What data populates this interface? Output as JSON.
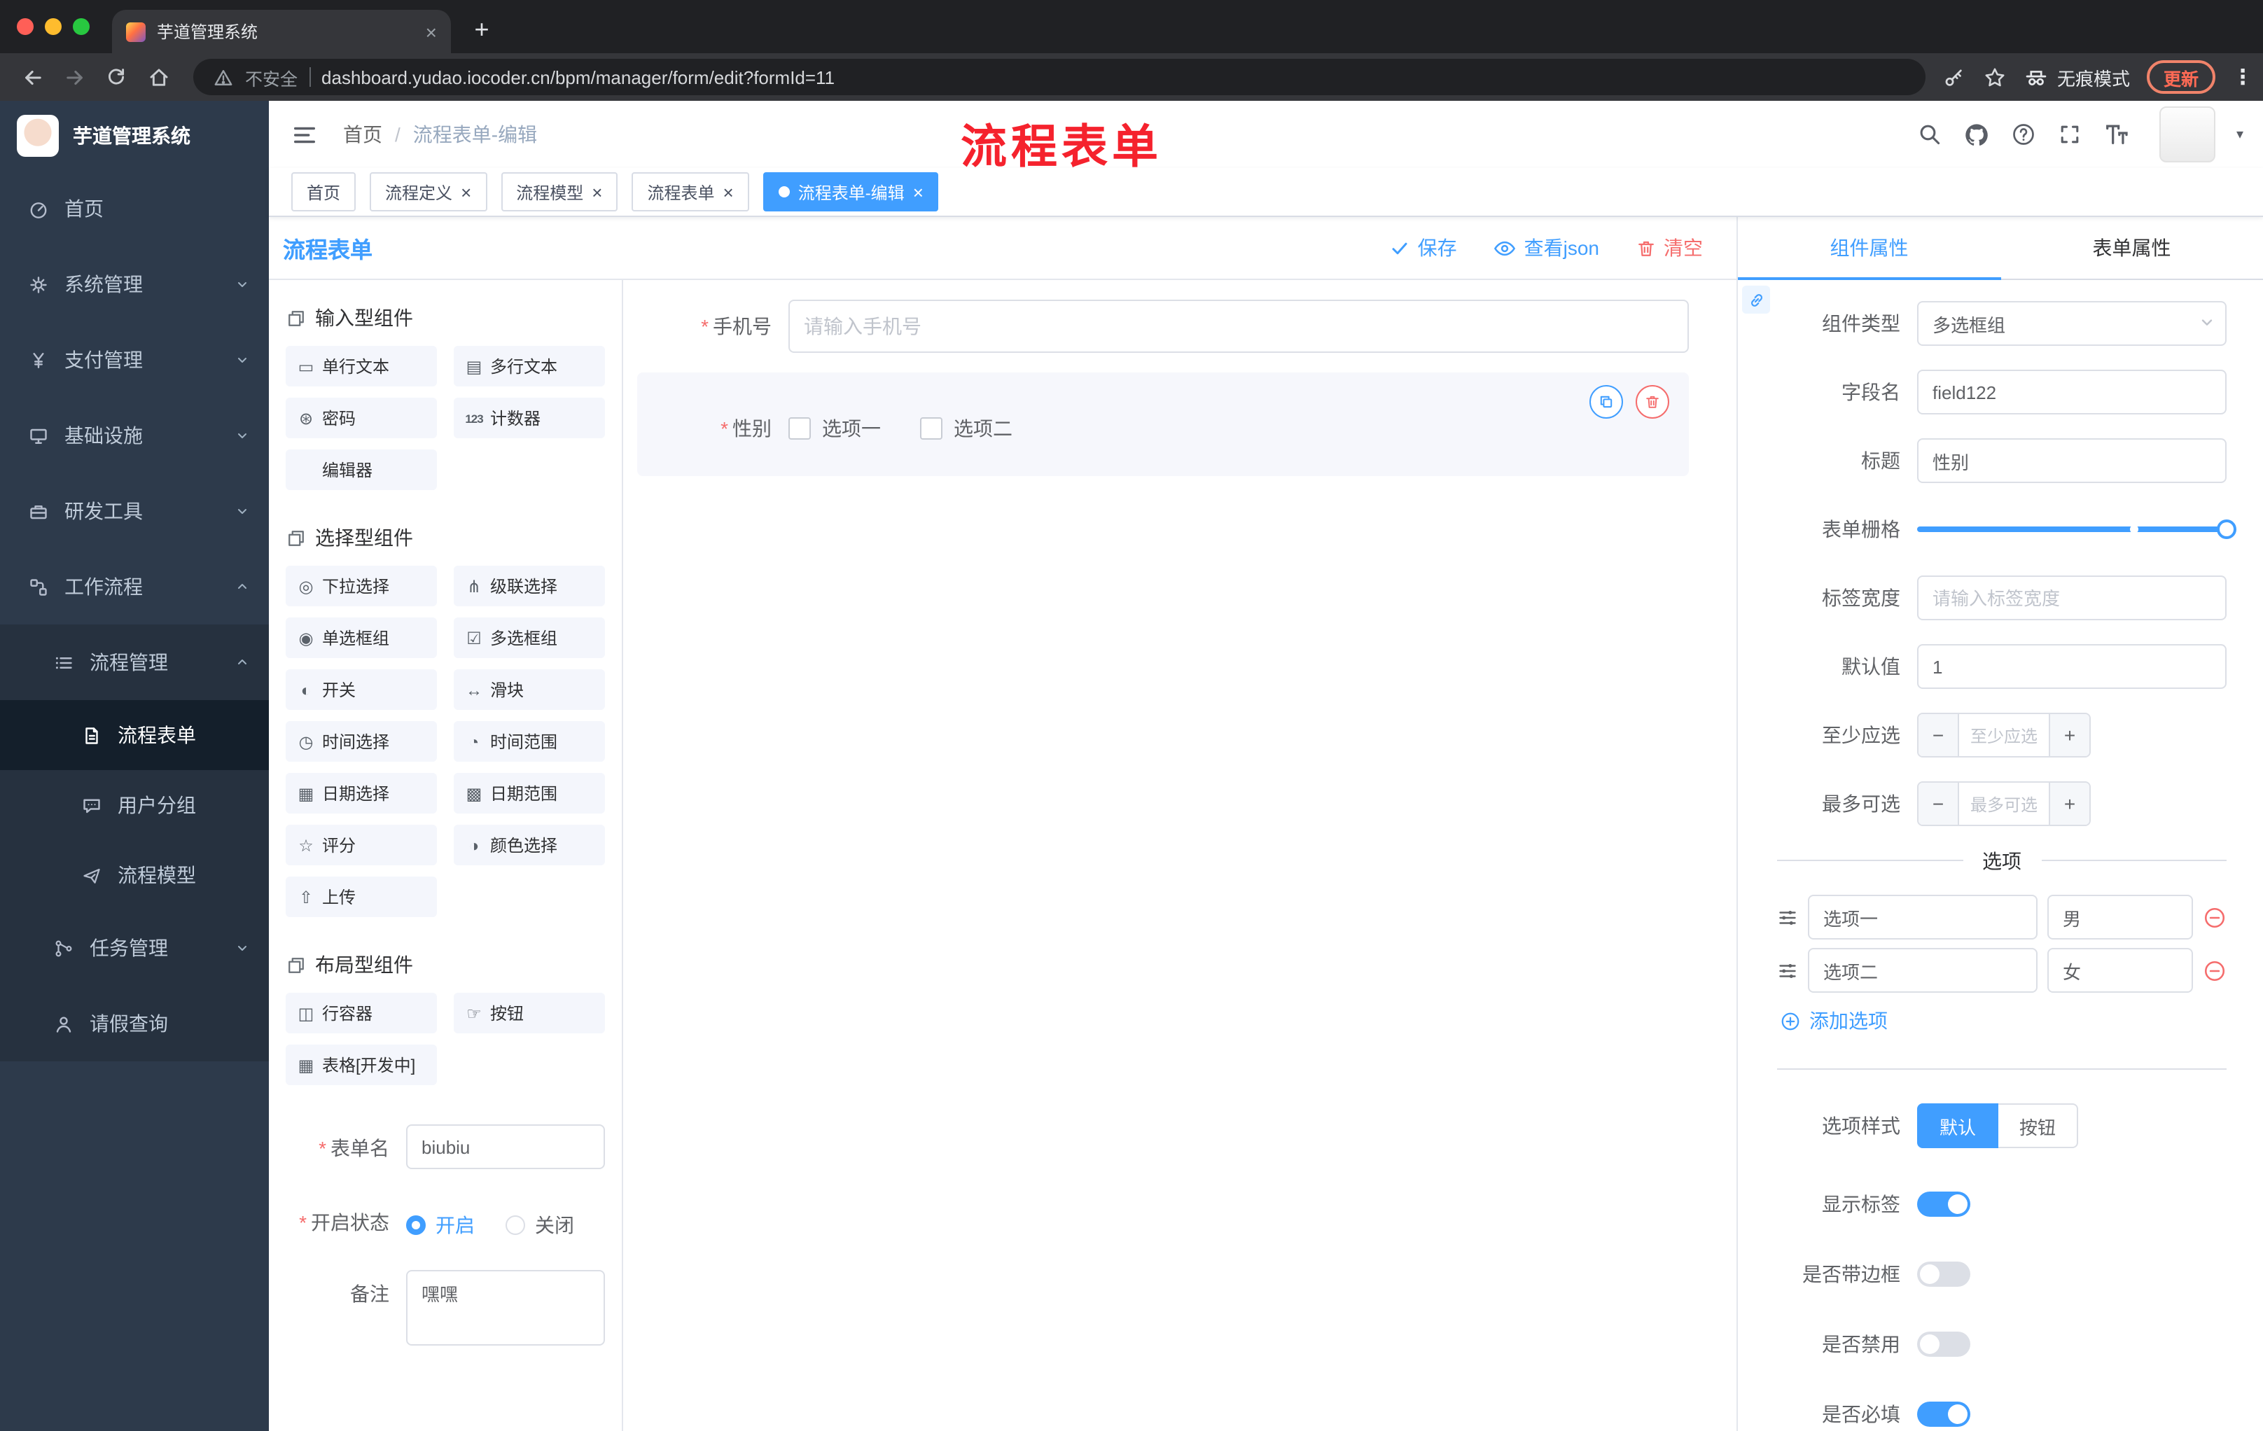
{
  "colors": {
    "accent": "#409eff",
    "danger": "#f56c6c",
    "annotation_red": "#f5222d",
    "sidebar_bg": "#2d3a4b"
  },
  "ui": {
    "close": "×",
    "plus": "+",
    "kebab": "⋮",
    "caret": "▾",
    "slash": "/",
    "asterisk": "*",
    "minus": "−",
    "plus_sign": "+"
  },
  "browser": {
    "tab_title": "芋道管理系统",
    "security_label": "不安全",
    "url": "dashboard.yudao.iocoder.cn/bpm/manager/form/edit?formId=11",
    "incognito_label": "无痕模式",
    "update_label": "更新"
  },
  "sidebar": {
    "brand": "芋道管理系统",
    "items": [
      {
        "label": "首页"
      },
      {
        "label": "系统管理"
      },
      {
        "label": "支付管理"
      },
      {
        "label": "基础设施"
      },
      {
        "label": "研发工具"
      },
      {
        "label": "工作流程",
        "expanded": true
      },
      {
        "label": "流程管理",
        "expanded": true
      },
      {
        "label": "流程表单",
        "active": true
      },
      {
        "label": "用户分组"
      },
      {
        "label": "流程模型"
      },
      {
        "label": "任务管理"
      },
      {
        "label": "请假查询"
      }
    ]
  },
  "header": {
    "breadcrumb": [
      "首页",
      "流程表单-编辑"
    ],
    "annotation": "流程表单"
  },
  "tags": [
    {
      "label": "首页",
      "closable": false,
      "active": false
    },
    {
      "label": "流程定义",
      "closable": true,
      "active": false
    },
    {
      "label": "流程模型",
      "closable": true,
      "active": false
    },
    {
      "label": "流程表单",
      "closable": true,
      "active": false
    },
    {
      "label": "流程表单-编辑",
      "closable": true,
      "active": true
    }
  ],
  "designer": {
    "title": "流程表单",
    "actions": {
      "save": "保存",
      "view_json": "查看json",
      "clear": "清空"
    },
    "groups": [
      {
        "title": "输入型组件",
        "items": [
          {
            "label": "单行文本",
            "icon": "▭"
          },
          {
            "label": "多行文本",
            "icon": "▤"
          },
          {
            "label": "密码",
            "icon": "⊛"
          },
          {
            "label": "计数器",
            "icon": "123"
          },
          {
            "label": "编辑器",
            "icon": ""
          }
        ]
      },
      {
        "title": "选择型组件",
        "items": [
          {
            "label": "下拉选择",
            "icon": "◎"
          },
          {
            "label": "级联选择",
            "icon": "⋔"
          },
          {
            "label": "单选框组",
            "icon": "◉"
          },
          {
            "label": "多选框组",
            "icon": "☑"
          },
          {
            "label": "开关",
            "icon": "◐"
          },
          {
            "label": "滑块",
            "icon": "↔"
          },
          {
            "label": "时间选择",
            "icon": "◷"
          },
          {
            "label": "时间范围",
            "icon": "◔"
          },
          {
            "label": "日期选择",
            "icon": "▦"
          },
          {
            "label": "日期范围",
            "icon": "▩"
          },
          {
            "label": "评分",
            "icon": "☆"
          },
          {
            "label": "颜色选择",
            "icon": "◑"
          },
          {
            "label": "上传",
            "icon": "⇧"
          }
        ]
      },
      {
        "title": "布局型组件",
        "items": [
          {
            "label": "行容器",
            "icon": "◫"
          },
          {
            "label": "按钮",
            "icon": "☞"
          },
          {
            "label": "表格[开发中]",
            "icon": "▦"
          }
        ]
      }
    ],
    "meta": {
      "name_label": "表单名",
      "name_value": "biubiu",
      "status_label": "开启状态",
      "status_options": [
        "开启",
        "关闭"
      ],
      "status_value": "开启",
      "remark_label": "备注",
      "remark_value": "嘿嘿"
    },
    "canvas": {
      "phone": {
        "label": "手机号",
        "placeholder": "请输入手机号",
        "required": true
      },
      "gender": {
        "label": "性别",
        "options": [
          "选项一",
          "选项二"
        ],
        "required": true
      }
    }
  },
  "props": {
    "tabs": [
      "组件属性",
      "表单属性"
    ],
    "active_tab": "组件属性",
    "component_type": {
      "label": "组件类型",
      "value": "多选框组"
    },
    "field_name": {
      "label": "字段名",
      "value": "field122"
    },
    "title": {
      "label": "标题",
      "value": "性别"
    },
    "grid": {
      "label": "表单栅格"
    },
    "label_width": {
      "label": "标签宽度",
      "placeholder": "请输入标签宽度"
    },
    "default_value": {
      "label": "默认值",
      "value": "1"
    },
    "min_checked": {
      "label": "至少应选",
      "placeholder": "至少应选"
    },
    "max_checked": {
      "label": "最多可选",
      "placeholder": "最多可选"
    },
    "options_title": "选项",
    "options": [
      {
        "name": "选项一",
        "value": "男"
      },
      {
        "name": "选项二",
        "value": "女"
      }
    ],
    "add_option": "添加选项",
    "option_style": {
      "label": "选项样式",
      "options": [
        "默认",
        "按钮"
      ],
      "active": "默认"
    },
    "switches": [
      {
        "label": "显示标签",
        "on": true
      },
      {
        "label": "是否带边框",
        "on": false
      },
      {
        "label": "是否禁用",
        "on": false
      },
      {
        "label": "是否必填",
        "on": true
      }
    ]
  }
}
